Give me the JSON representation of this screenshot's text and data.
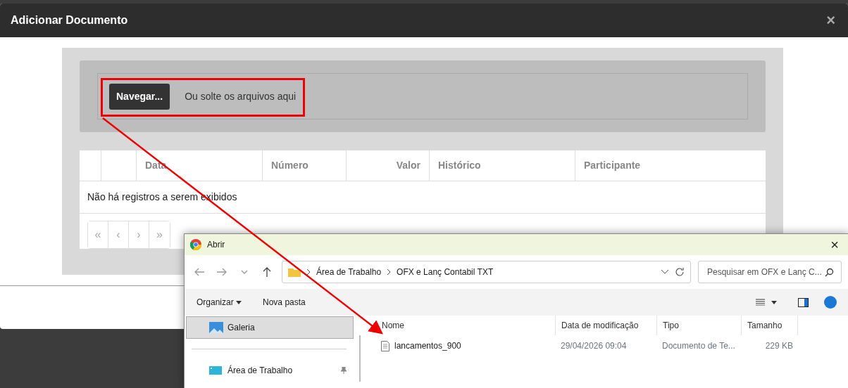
{
  "modal": {
    "title": "Adicionar Documento",
    "close": "×"
  },
  "upload": {
    "button": "Navegar...",
    "hint": "Ou solte os arquivos aqui"
  },
  "table": {
    "columns": [
      {
        "label": "Data",
        "numeric": false
      },
      {
        "label": "Número",
        "numeric": false
      },
      {
        "label": "Valor",
        "numeric": true
      },
      {
        "label": "Histórico",
        "numeric": false
      },
      {
        "label": "Participante",
        "numeric": false
      }
    ],
    "empty_message": "Não há registros a serem exibidos",
    "pagination": [
      "«",
      "‹",
      "›",
      "»"
    ]
  },
  "file_dialog": {
    "title": "Abrir",
    "close": "×",
    "breadcrumb": [
      "Área de Trabalho",
      "OFX e Lanç Contabil TXT"
    ],
    "search_placeholder": "Pesquisar em OFX e Lanç C...",
    "toolbar": [
      {
        "label": "Organizar",
        "kind": "dropdown"
      },
      {
        "label": "Nova pasta",
        "kind": "plain"
      }
    ],
    "nav_items": [
      {
        "label": "Galeria",
        "kind": "gallery",
        "selected": true,
        "pinned": false
      },
      {
        "label": "Área de Trabalho",
        "kind": "desktop",
        "selected": false,
        "pinned": true
      }
    ],
    "columns": [
      "Nome",
      "Data de modificação",
      "Tipo",
      "Tamanho"
    ],
    "files": [
      {
        "name": "lancamentos_900",
        "modified": "29/04/2026 09:04",
        "type": "Documento de Te...",
        "size": "229 KB"
      }
    ]
  }
}
